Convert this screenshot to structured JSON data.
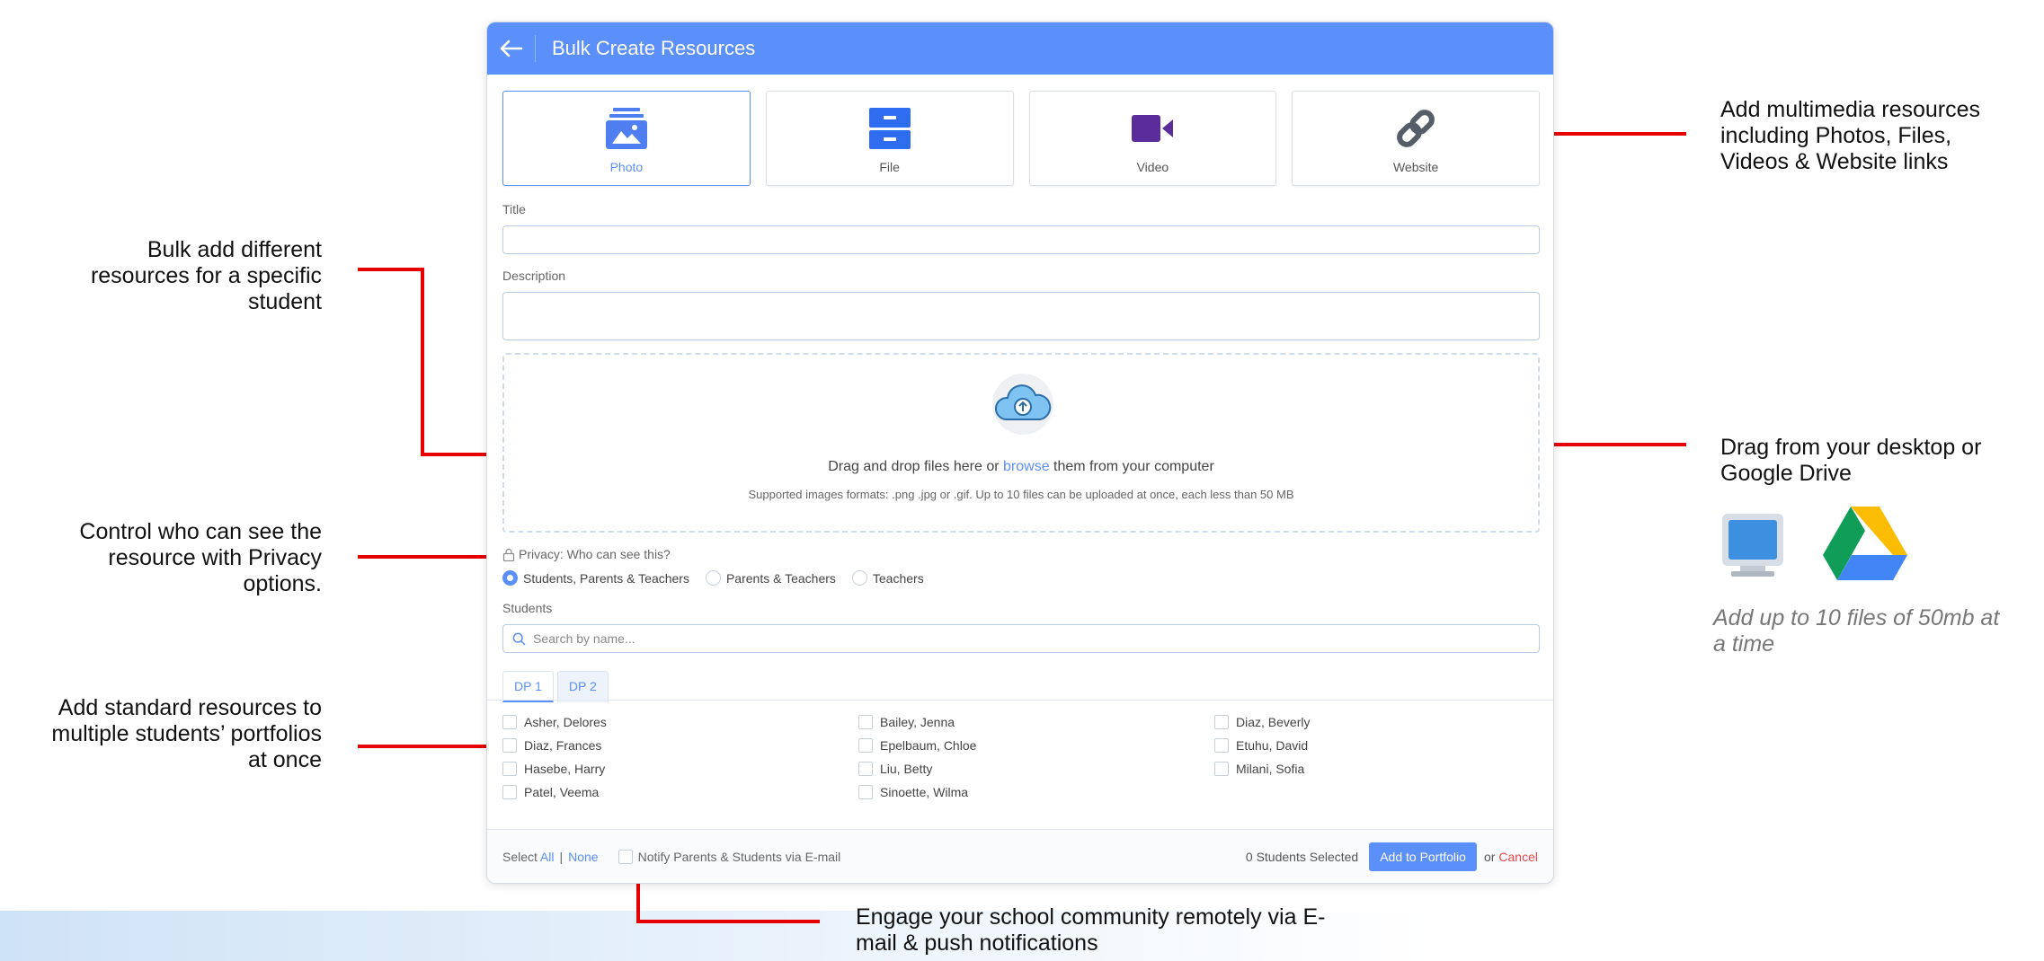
{
  "modal": {
    "title": "Bulk Create Resources",
    "resource_types": [
      {
        "label": "Photo",
        "icon": "photo-icon",
        "selected": true
      },
      {
        "label": "File",
        "icon": "file-icon",
        "selected": false
      },
      {
        "label": "Video",
        "icon": "video-icon",
        "selected": false
      },
      {
        "label": "Website",
        "icon": "link-icon",
        "selected": false
      }
    ],
    "title_field": {
      "label": "Title",
      "value": ""
    },
    "description_field": {
      "label": "Description",
      "value": ""
    },
    "dropzone": {
      "text_before": "Drag and drop files here or ",
      "link": "browse",
      "text_after": " them from your computer",
      "supported": "Supported images formats: .png .jpg or .gif. Up to 10 files can be uploaded at once, each less than 50 MB"
    },
    "privacy": {
      "label": "Privacy: Who can see this?",
      "options": [
        "Students, Parents & Teachers",
        "Parents & Teachers",
        "Teachers"
      ],
      "selected": "Students, Parents & Teachers"
    },
    "students": {
      "label": "Students",
      "search_placeholder": "Search by name...",
      "tabs": [
        "DP 1",
        "DP 2"
      ],
      "active_tab": "DP 1",
      "list": [
        "Asher, Delores",
        "Bailey, Jenna",
        "Diaz, Beverly",
        "Diaz, Frances",
        "Epelbaum, Chloe",
        "Etuhu, David",
        "Hasebe, Harry",
        "Liu, Betty",
        "Milani, Sofia",
        "Patel, Veema",
        "Sinoette, Wilma"
      ]
    },
    "footer": {
      "select_label": "Select",
      "all": "All",
      "separator": "|",
      "none": "None",
      "notify_label": "Notify Parents & Students via E-mail",
      "selected_count": "0 Students Selected",
      "add_button": "Add to Portfolio",
      "or": "or",
      "cancel": "Cancel"
    }
  },
  "annotations": {
    "bulk_add": "Bulk add different resources for a specific student",
    "privacy": "Control who can see the resource with Privacy options.",
    "standard": "Add standard resources to multiple students’ portfolios at once",
    "multimedia": "Add multimedia resources including Photos, Files, Videos & Website links",
    "drag": "Drag from your desktop or Google Drive",
    "limit": "Add up to 10 files of 50mb at a time",
    "engage": "Engage your school community remotely via E-mail & push notifications"
  },
  "colors": {
    "accent": "#5b8ff9",
    "callout_line": "#e60000",
    "cancel": "#e5484d"
  }
}
